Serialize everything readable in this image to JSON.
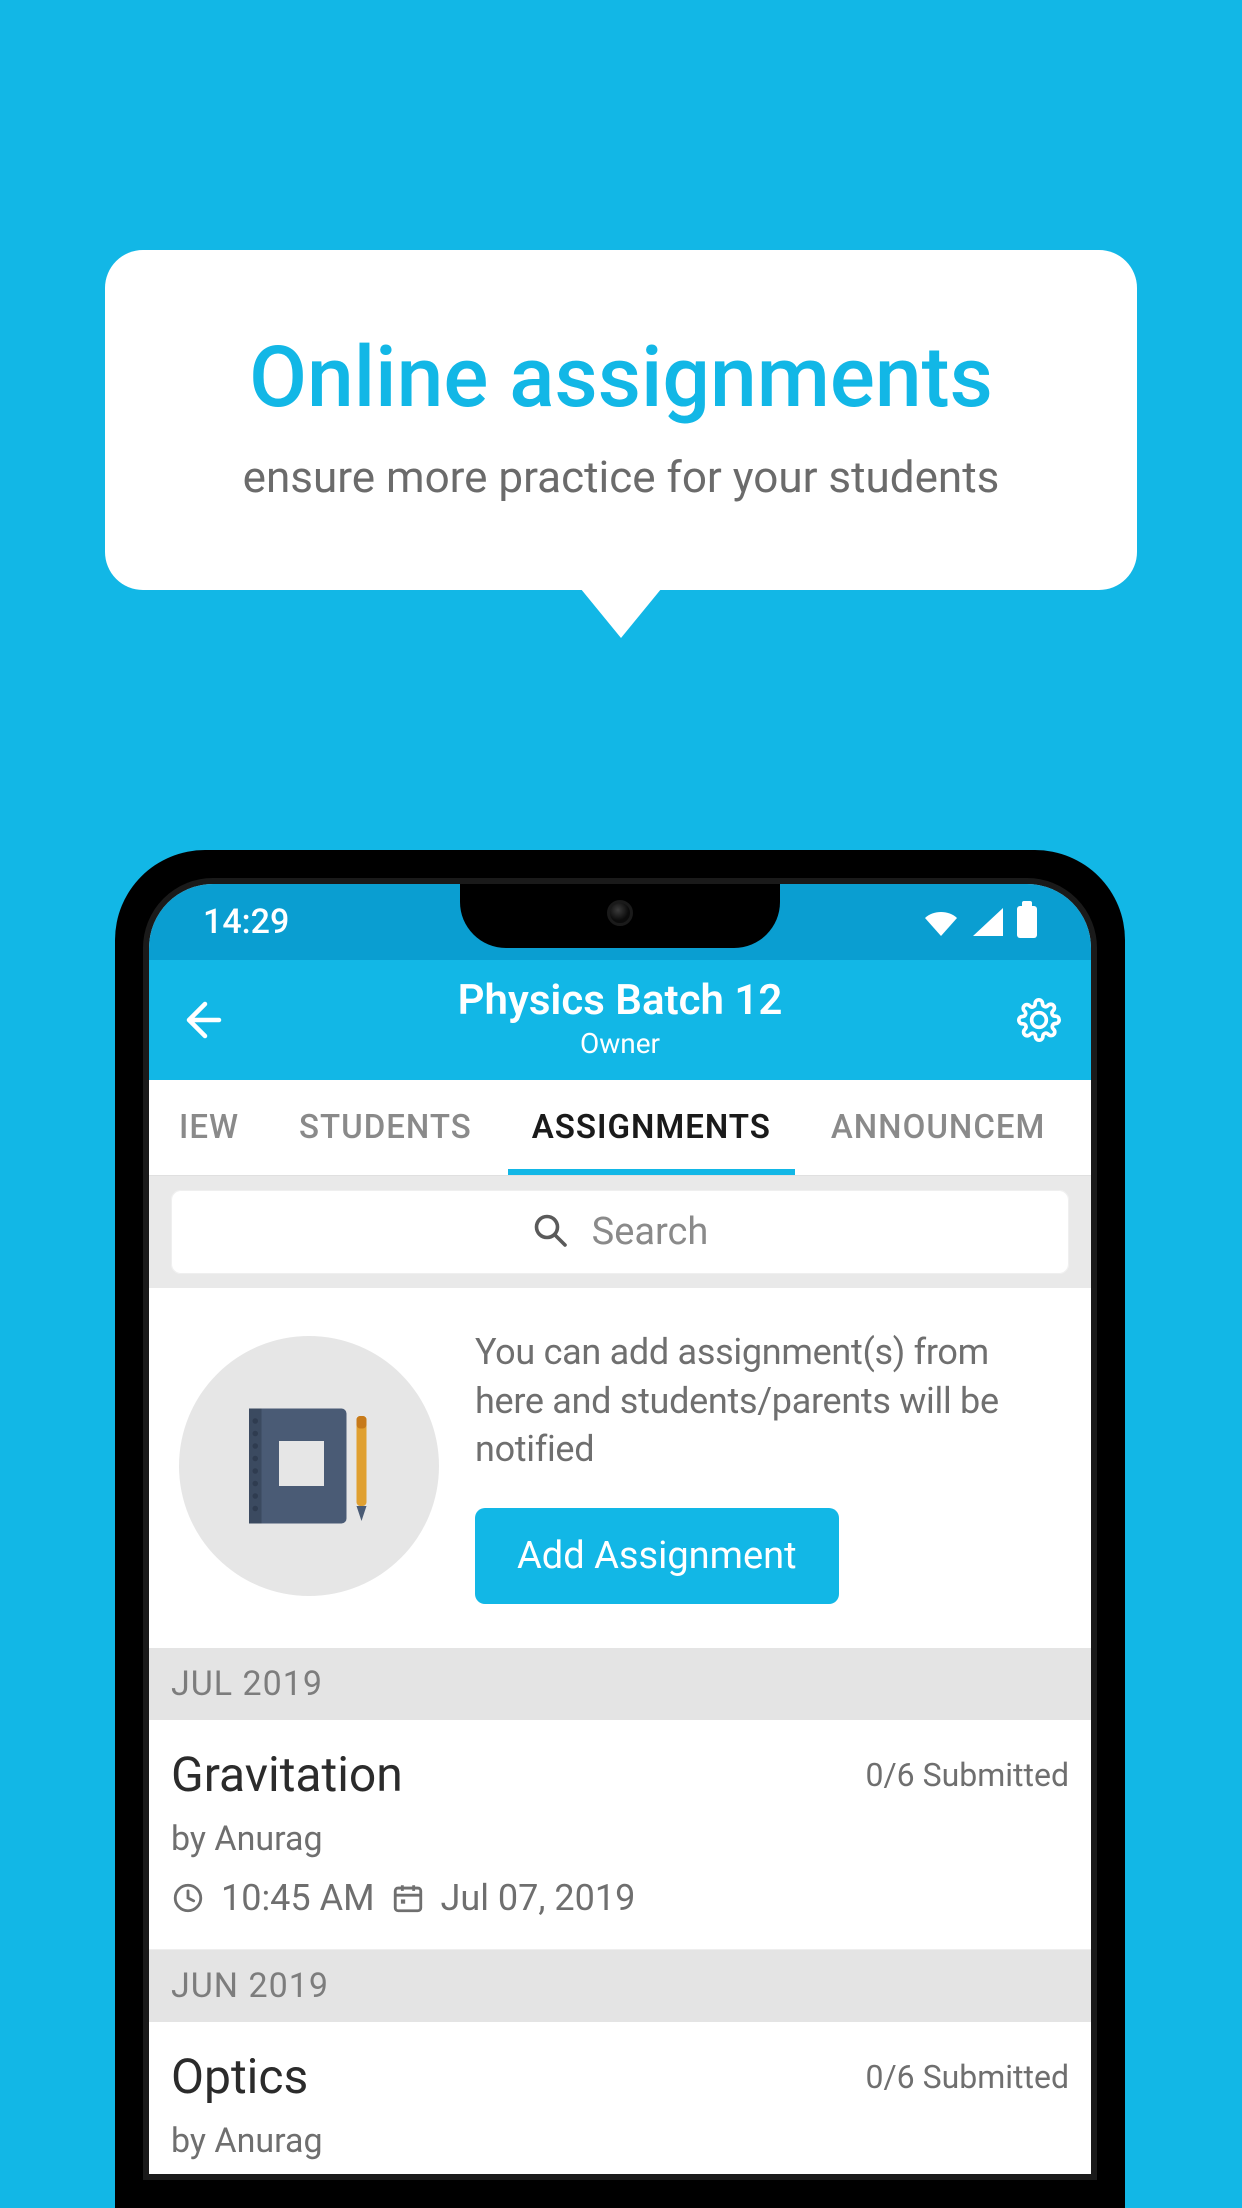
{
  "promo": {
    "title": "Online assignments",
    "subtitle": "ensure more practice for your students"
  },
  "statusbar": {
    "time": "14:29"
  },
  "header": {
    "title": "Physics Batch 12",
    "role": "Owner"
  },
  "tabs": [
    {
      "label": "IEW",
      "active": false
    },
    {
      "label": "STUDENTS",
      "active": false
    },
    {
      "label": "ASSIGNMENTS",
      "active": true
    },
    {
      "label": "ANNOUNCEM",
      "active": false
    }
  ],
  "search": {
    "placeholder": "Search"
  },
  "info": {
    "text": "You can add assignment(s) from here and students/parents will be notified",
    "button": "Add Assignment"
  },
  "sections": [
    {
      "month": "JUL 2019",
      "items": [
        {
          "title": "Gravitation",
          "status": "0/6 Submitted",
          "by": "by Anurag",
          "time": "10:45 AM",
          "date": "Jul 07, 2019"
        }
      ]
    },
    {
      "month": "JUN 2019",
      "items": [
        {
          "title": "Optics",
          "status": "0/6 Submitted",
          "by": "by Anurag",
          "time": "",
          "date": ""
        }
      ]
    }
  ]
}
